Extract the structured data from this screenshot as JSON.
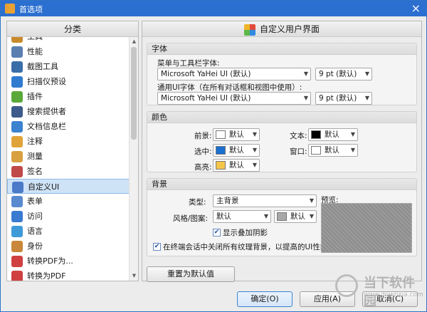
{
  "window": {
    "title": "首选项"
  },
  "sidebar": {
    "header": "分类",
    "items": [
      {
        "label": "工具",
        "icon": "tools-icon",
        "color": "#c98a2b"
      },
      {
        "label": "性能",
        "icon": "gauge-icon",
        "color": "#5b7fb0"
      },
      {
        "label": "截图工具",
        "icon": "camera-icon",
        "color": "#3a6ea8"
      },
      {
        "label": "扫描仪预设",
        "icon": "scanner-icon",
        "color": "#2f7bd0"
      },
      {
        "label": "插件",
        "icon": "puzzle-icon",
        "color": "#5aa83a"
      },
      {
        "label": "搜索提供者",
        "icon": "search-provider-icon",
        "color": "#3d5a8a"
      },
      {
        "label": "文档信息栏",
        "icon": "info-icon",
        "color": "#3b82d0"
      },
      {
        "label": "注释",
        "icon": "comment-icon",
        "color": "#e0a33a"
      },
      {
        "label": "测量",
        "icon": "ruler-icon",
        "color": "#d8a040"
      },
      {
        "label": "签名",
        "icon": "signature-icon",
        "color": "#c04a4a"
      },
      {
        "label": "自定义UI",
        "icon": "customize-ui-icon",
        "color": "#4a7ac8",
        "selected": true
      },
      {
        "label": "表单",
        "icon": "form-icon",
        "color": "#5a8ad0"
      },
      {
        "label": "访问",
        "icon": "access-icon",
        "color": "#3a7ad0"
      },
      {
        "label": "语言",
        "icon": "language-icon",
        "color": "#3f9ad8"
      },
      {
        "label": "身份",
        "icon": "identity-icon",
        "color": "#c8873a"
      },
      {
        "label": "转换PDF为...",
        "icon": "convert-from-pdf-icon",
        "color": "#d04040"
      },
      {
        "label": "转换为PDF",
        "icon": "convert-to-pdf-icon",
        "color": "#d04040"
      }
    ]
  },
  "main": {
    "header": "自定义用户界面",
    "font": {
      "title": "字体",
      "menu_label": "菜单与工具栏字体:",
      "menu_font": "Microsoft YaHei UI (默认)",
      "menu_size": "9 pt (默认)",
      "ui_label": "通用UI字体（在所有对话框和视图中使用）:",
      "ui_font": "Microsoft YaHei UI (默认)",
      "ui_size": "9 pt (默认)"
    },
    "color": {
      "title": "颜色",
      "fg_label": "前景:",
      "fg_value": "默认",
      "fg_color": "#ffffff",
      "sel_label": "选中:",
      "sel_value": "默认",
      "sel_color": "#1a6fd0",
      "hl_label": "高亮:",
      "hl_value": "默认",
      "hl_color": "#f5c64a",
      "text_label": "文本:",
      "text_value": "默认",
      "text_color": "#000000",
      "win_label": "窗口:",
      "win_value": "默认",
      "win_color": "#ffffff"
    },
    "background": {
      "title": "背景",
      "type_label": "类型:",
      "type_value": "主背景",
      "style_label": "风格/图案:",
      "style_value": "默认",
      "style_color_value": "默认",
      "style_color": "#a8a8a8",
      "preview_label": "预览:",
      "shadow_label": "显示叠加阴影",
      "shadow_checked": true,
      "terminal_label": "在终端会话中关闭所有纹理背景，以提高的UI性能",
      "terminal_checked": true
    },
    "reset_label": "重置为默认值"
  },
  "footer": {
    "ok_label": "确定(O)",
    "apply_label": "应用(A)",
    "cancel_label": "取消(C)"
  },
  "watermark": {
    "cn": "当下软件园",
    "en": "www.downxia.com"
  }
}
